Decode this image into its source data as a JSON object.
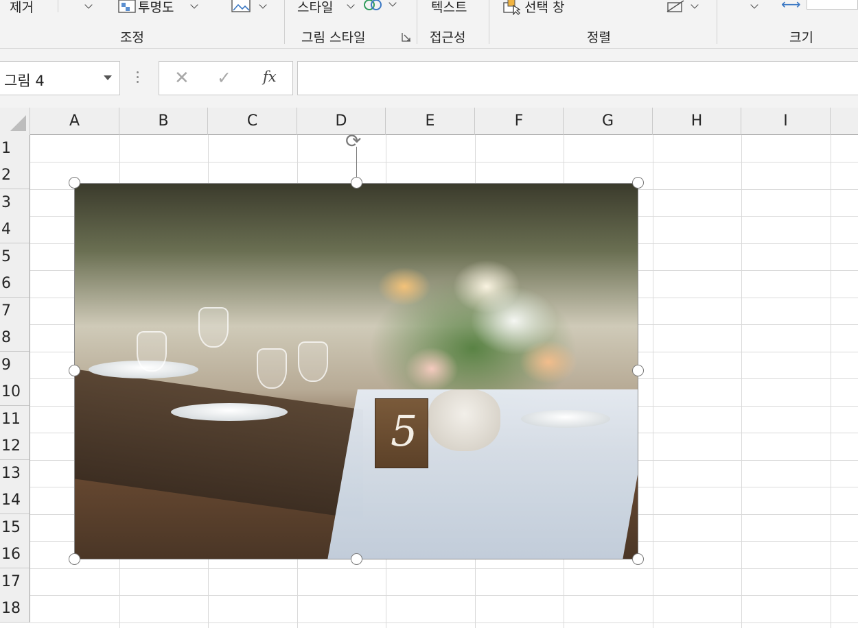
{
  "ribbon": {
    "btn_remove": "제거",
    "btn_transparency": "투명도",
    "btn_styles": "스타일",
    "btn_text": "텍스트",
    "btn_selection_pane": "선택 창",
    "groups": {
      "adjust": "조정",
      "picture_styles": "그림 스타일",
      "accessibility": "접근성",
      "arrange": "정렬",
      "size": "크기"
    }
  },
  "formula_bar": {
    "name_box": "그림 4",
    "cancel_symbol": "✕",
    "enter_symbol": "✓",
    "function_symbol": "fx",
    "formula_value": ""
  },
  "columns": [
    "A",
    "B",
    "C",
    "D",
    "E",
    "F",
    "G",
    "H",
    "I"
  ],
  "rows": [
    "1",
    "2",
    "3",
    "4",
    "5",
    "6",
    "7",
    "8",
    "9",
    "10",
    "11",
    "12",
    "13",
    "14",
    "15",
    "16",
    "17",
    "18"
  ],
  "picture": {
    "table_number": "5"
  },
  "icons": {
    "picture_icon": "picture-icon",
    "rotate_icon": "rotate-handle-icon",
    "selection_pane_icon": "selection-pane-icon",
    "recolor_icon": "recolor-icon",
    "size_arrows_icon": "width-arrows-icon"
  }
}
